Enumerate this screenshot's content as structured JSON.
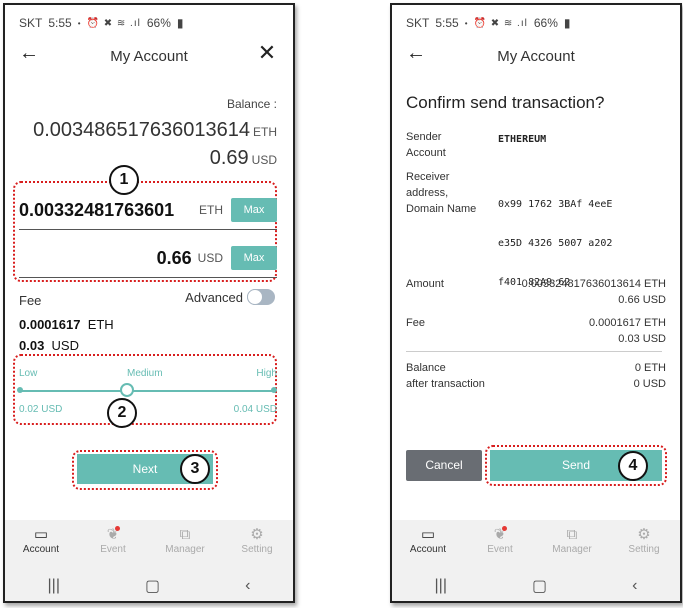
{
  "colors": {
    "accent": "#66bcb3",
    "annotation": "#d81e1e",
    "cancel": "#696d73"
  },
  "status": {
    "carrier": "SKT",
    "time": "5:55",
    "battery": "66%"
  },
  "screen1": {
    "title": "My Account",
    "balance_label": "Balance :",
    "balance_eth": "0.003486517636013614",
    "balance_usd": "0.69",
    "eth_unit": "ETH",
    "usd_unit": "USD",
    "amount_eth": "0.00332481763601",
    "amount_usd": "0.66",
    "max_label": "Max",
    "fee_label": "Fee",
    "advanced_label": "Advanced",
    "fee_eth": "0.0001617",
    "fee_usd": "0.03",
    "slider": {
      "low": "Low",
      "medium": "Medium",
      "high": "High",
      "min_usd": "0.02 USD",
      "max_usd": "0.04 USD",
      "level": 0.42
    },
    "next_label": "Next",
    "markers": [
      "1",
      "2",
      "3"
    ]
  },
  "screen2": {
    "title": "My Account",
    "heading": "Confirm send transaction?",
    "sender_label_1": "Sender",
    "sender_label_2": "Account",
    "sender_value": "ETHEREUM",
    "receiver_label_1": "Receiver",
    "receiver_label_2": "address,",
    "receiver_label_3": "Domain Name",
    "receiver_line_1": "0x99 1762 3BAf 4eeE",
    "receiver_line_2": "e35D 4326 5007 a202",
    "receiver_line_3": "f401 82A9 62",
    "amount_label": "Amount",
    "amount_eth": "0.003324817636013614 ETH",
    "amount_usd": "0.66 USD",
    "fee_label": "Fee",
    "fee_eth": "0.0001617 ETH",
    "fee_usd": "0.03 USD",
    "balance_label_1": "Balance",
    "balance_label_2": "after transaction",
    "balance_eth": "0 ETH",
    "balance_usd": "0 USD",
    "cancel_label": "Cancel",
    "send_label": "Send",
    "marker": "4"
  },
  "nav": {
    "items": [
      "Account",
      "Event",
      "Manager",
      "Setting"
    ]
  },
  "icons": {
    "wallet": "wallet-icon",
    "event": "balloon-icon",
    "manager": "manager-icon",
    "setting": "gear-icon"
  }
}
